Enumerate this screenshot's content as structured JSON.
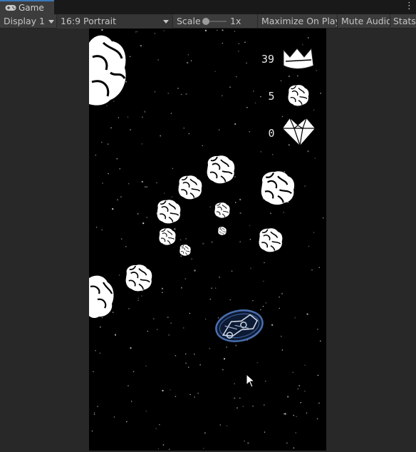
{
  "tab": {
    "title": "Game"
  },
  "toolbar": {
    "display": "Display 1",
    "aspect": "16:9 Portrait",
    "scale_label": "Scale",
    "scale_value": "1x",
    "maximize": "Maximize On Play",
    "mute": "Mute Audio",
    "stats": "Stats"
  },
  "menu": {
    "kebab": "⋮"
  },
  "hud": {
    "score": "39",
    "score_icon": "crown-icon",
    "asteroids": "5",
    "asteroid_icon": "asteroid-icon",
    "gems": "0",
    "gem_icon": "gem-icon"
  },
  "colors": {
    "tab_accent": "#3a79bb",
    "toolbar_bg": "#3c3c3c",
    "canvas_bg": "#000000",
    "asteroid_fill": "#ffffff",
    "ship_outline": "#4a6fb0"
  }
}
